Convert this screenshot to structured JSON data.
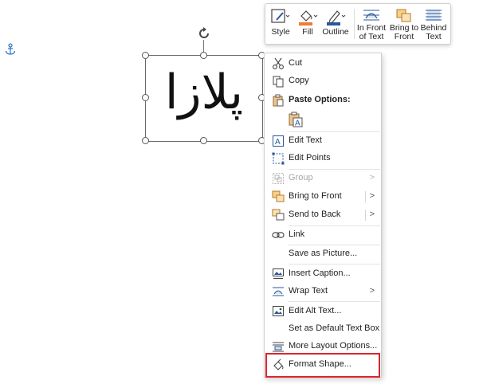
{
  "mini_toolbar": {
    "style": "Style",
    "fill": "Fill",
    "outline": "Outline",
    "in_front_l1": "In Front",
    "in_front_l2": "of Text",
    "bring_front_l1": "Bring to",
    "bring_front_l2": "Front",
    "behind_l1": "Behind",
    "behind_l2": "Text"
  },
  "shape": {
    "text": "پلازا"
  },
  "menu": {
    "cut": "Cut",
    "copy": "Copy",
    "paste_options": "Paste Options:",
    "edit_text": "Edit Text",
    "edit_points": "Edit Points",
    "group": "Group",
    "bring_to_front": "Bring to Front",
    "send_to_back": "Send to Back",
    "link": "Link",
    "save_as_picture": "Save as Picture...",
    "insert_caption": "Insert Caption...",
    "wrap_text": "Wrap Text",
    "edit_alt_text": "Edit Alt Text...",
    "set_default_text_box": "Set as Default Text Box",
    "more_layout_options": "More Layout Options...",
    "format_shape": "Format Shape..."
  },
  "colors": {
    "accent": "#2b579a",
    "fill_orange": "#ed7d31",
    "highlight_red": "#d9262b"
  }
}
